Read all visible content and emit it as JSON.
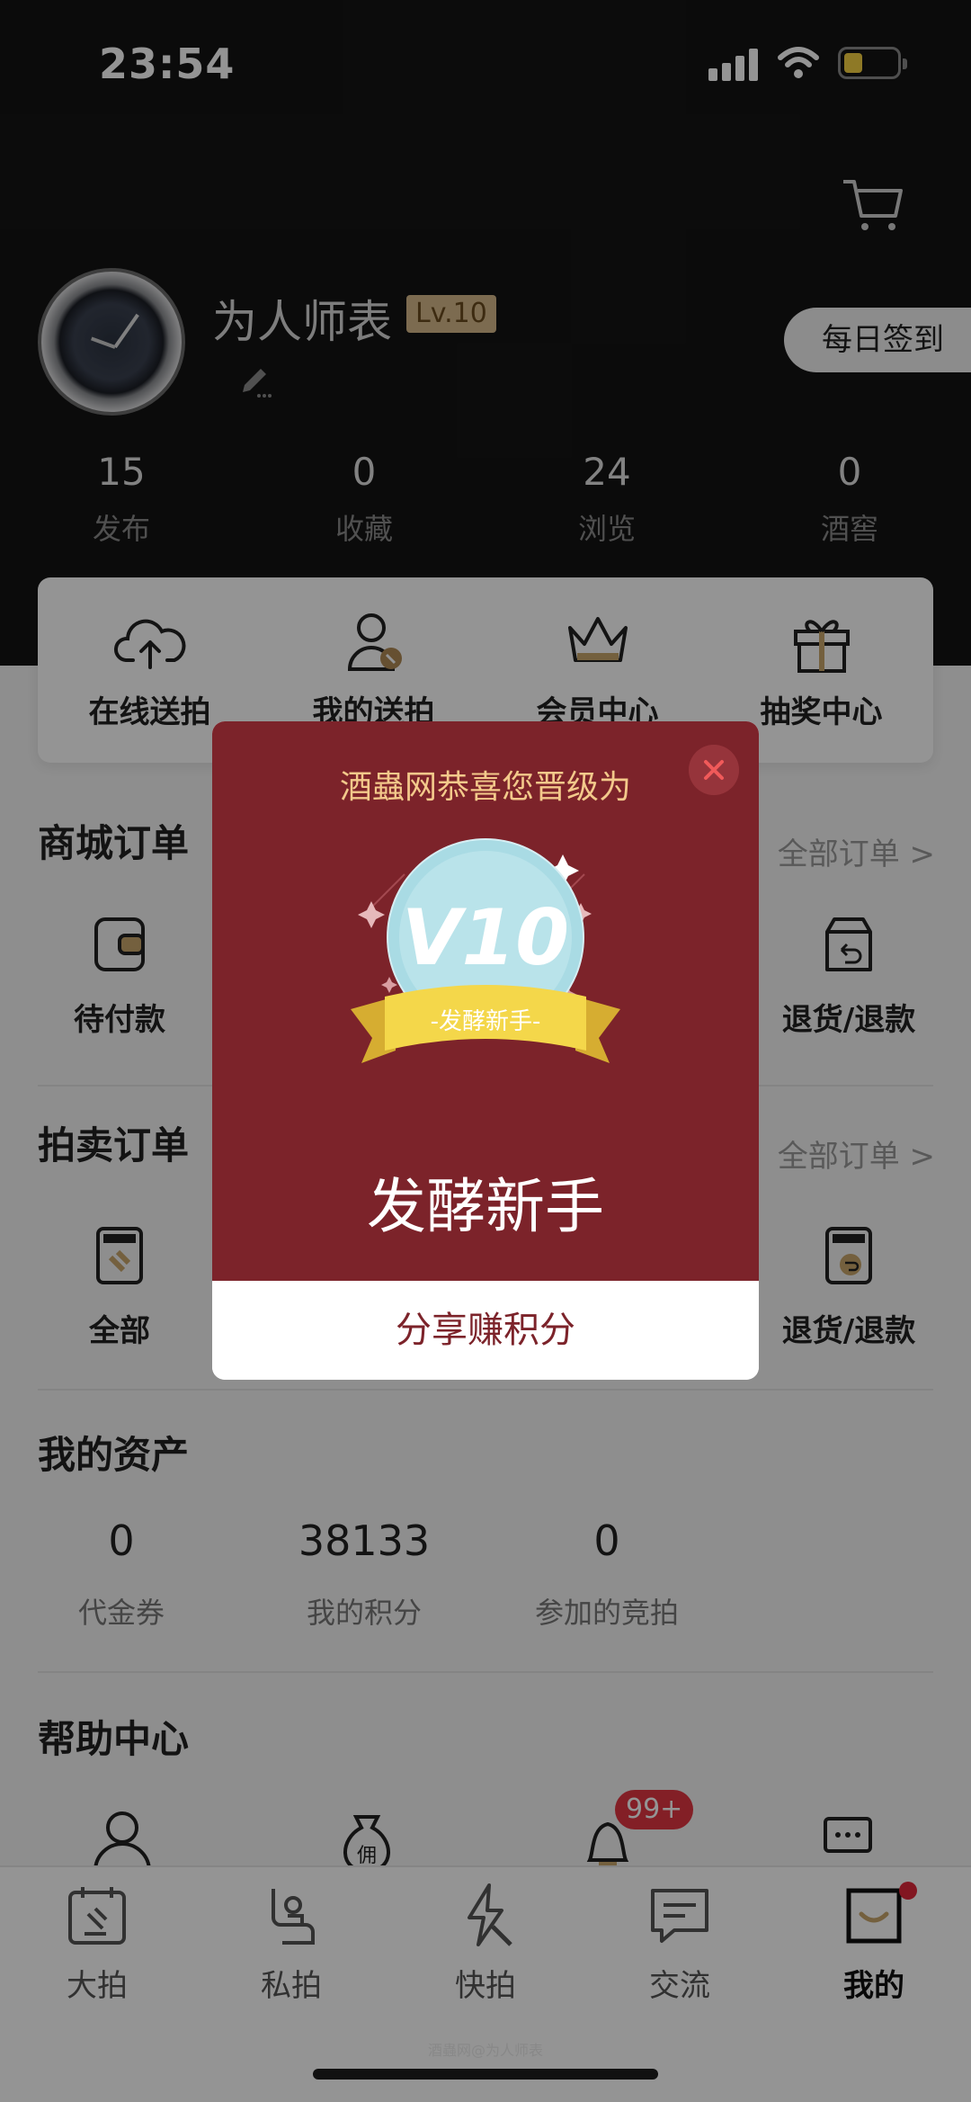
{
  "status_bar": {
    "time": "23:54"
  },
  "profile": {
    "username": "为人师表",
    "level_badge": "Lv.10",
    "sign_in_button": "每日签到"
  },
  "stats": [
    {
      "value": "15",
      "label": "发布"
    },
    {
      "value": "0",
      "label": "收藏"
    },
    {
      "value": "24",
      "label": "浏览"
    },
    {
      "value": "0",
      "label": "酒窖"
    }
  ],
  "services": [
    {
      "label": "在线送拍",
      "icon": "cloud-upload-icon"
    },
    {
      "label": "我的送拍",
      "icon": "user-gavel-icon"
    },
    {
      "label": "会员中心",
      "icon": "crown-icon"
    },
    {
      "label": "抽奖中心",
      "icon": "gift-icon"
    }
  ],
  "shop_orders": {
    "title": "商城订单",
    "link": "全部订单 >",
    "items": [
      {
        "label": "待付款",
        "icon": "wallet-icon"
      },
      {
        "label": "退货/退款",
        "icon": "return-box-icon"
      }
    ]
  },
  "auction_orders": {
    "title": "拍卖订单",
    "link": "全部订单 >",
    "items": [
      {
        "label": "全部",
        "icon": "auction-doc-icon"
      },
      {
        "label": "退货/退款",
        "icon": "auction-return-icon"
      }
    ]
  },
  "assets": {
    "title": "我的资产",
    "items": [
      {
        "value": "0",
        "label": "代金券"
      },
      {
        "value": "38133",
        "label": "我的积分"
      },
      {
        "value": "0",
        "label": "参加的竞拍"
      }
    ]
  },
  "help": {
    "title": "帮助中心",
    "notification_badge": "99+"
  },
  "tabbar": [
    {
      "label": "大拍",
      "icon": "auction-calendar-icon"
    },
    {
      "label": "私拍",
      "icon": "seat-person-icon"
    },
    {
      "label": "快拍",
      "icon": "lightning-gavel-icon"
    },
    {
      "label": "交流",
      "icon": "chat-icon"
    },
    {
      "label": "我的",
      "icon": "bag-smile-icon",
      "active": true
    }
  ],
  "watermark": "酒蟲网@为人师表",
  "modal": {
    "heading": "酒蟲网恭喜您晋级为",
    "medal_text": "V10",
    "ribbon_text": "-发酵新手-",
    "level_name": "发酵新手",
    "share_button": "分享赚积分"
  },
  "colors": {
    "header_bg": "#141414",
    "modal_red": "#7c232a",
    "modal_heading": "#f3c98b",
    "badge_red": "#e23642",
    "level_badge_bg": "#d6b98a"
  }
}
